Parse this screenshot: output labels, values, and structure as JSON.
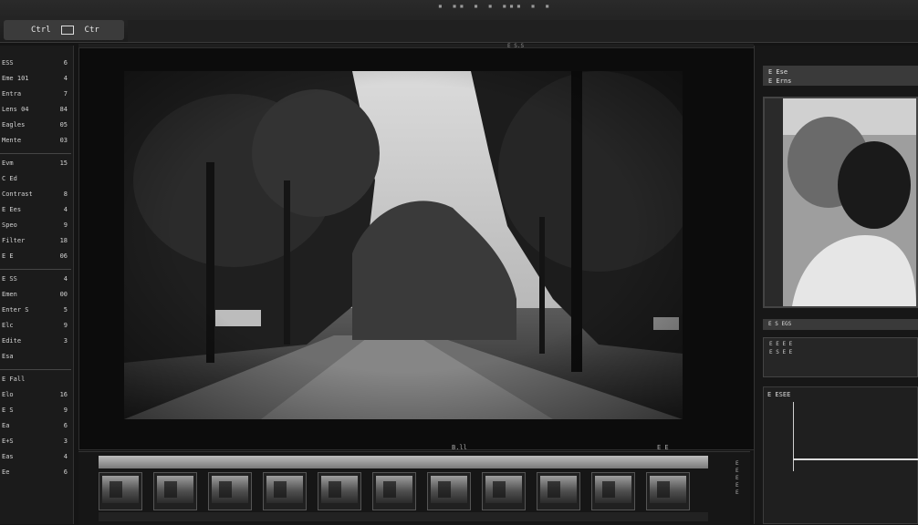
{
  "app": {
    "title_label": "Ctrl",
    "tab_label": "Ctr"
  },
  "left_panel": {
    "rows": [
      {
        "label": "ESS",
        "value": "6"
      },
      {
        "label": "Eme 101",
        "value": "4"
      },
      {
        "label": "Entra",
        "value": "7"
      },
      {
        "label": "Lens 04",
        "value": "84"
      },
      {
        "label": "Eagles",
        "value": "05"
      },
      {
        "label": "Mente",
        "value": "03"
      },
      {
        "label": "Evm",
        "value": "15"
      },
      {
        "label": "C Ed",
        "value": ""
      },
      {
        "label": "Contrast",
        "value": "8"
      },
      {
        "label": "E Ees",
        "value": "4"
      },
      {
        "label": "Speo",
        "value": "9"
      },
      {
        "label": "Filter",
        "value": "18"
      },
      {
        "label": "E E",
        "value": "06"
      },
      {
        "label": "E SS",
        "value": "4"
      },
      {
        "label": "Emen",
        "value": "00"
      },
      {
        "label": "Enter S",
        "value": "5"
      },
      {
        "label": "Elc",
        "value": "9"
      },
      {
        "label": "Edite",
        "value": "3"
      },
      {
        "label": "Esa",
        "value": ""
      },
      {
        "label": "E Fall",
        "value": ""
      },
      {
        "label": "Elo",
        "value": "16"
      },
      {
        "label": "E S",
        "value": "9"
      },
      {
        "label": "Ea",
        "value": "6"
      },
      {
        "label": "E+S",
        "value": "3"
      },
      {
        "label": "Eas",
        "value": "4"
      },
      {
        "label": "Ee",
        "value": "6"
      }
    ]
  },
  "viewer": {
    "top_tag": "E S.S",
    "bottom_label": "B.ll",
    "bottom_label2": "E E"
  },
  "filmstrip": {
    "frame_count": 11,
    "side_labels": [
      "E",
      "E",
      "E",
      "E",
      "E"
    ]
  },
  "right_panel": {
    "header_line1": "E Ese",
    "header_line2": "E Erns",
    "bar_label": "E S EGS",
    "box_lines": [
      "E E E E",
      "E S E E"
    ],
    "graph_label": "E ESEE"
  },
  "colors": {
    "background": "#141414",
    "panel": "#1b1b1b",
    "highlight": "#bdbdbd"
  }
}
